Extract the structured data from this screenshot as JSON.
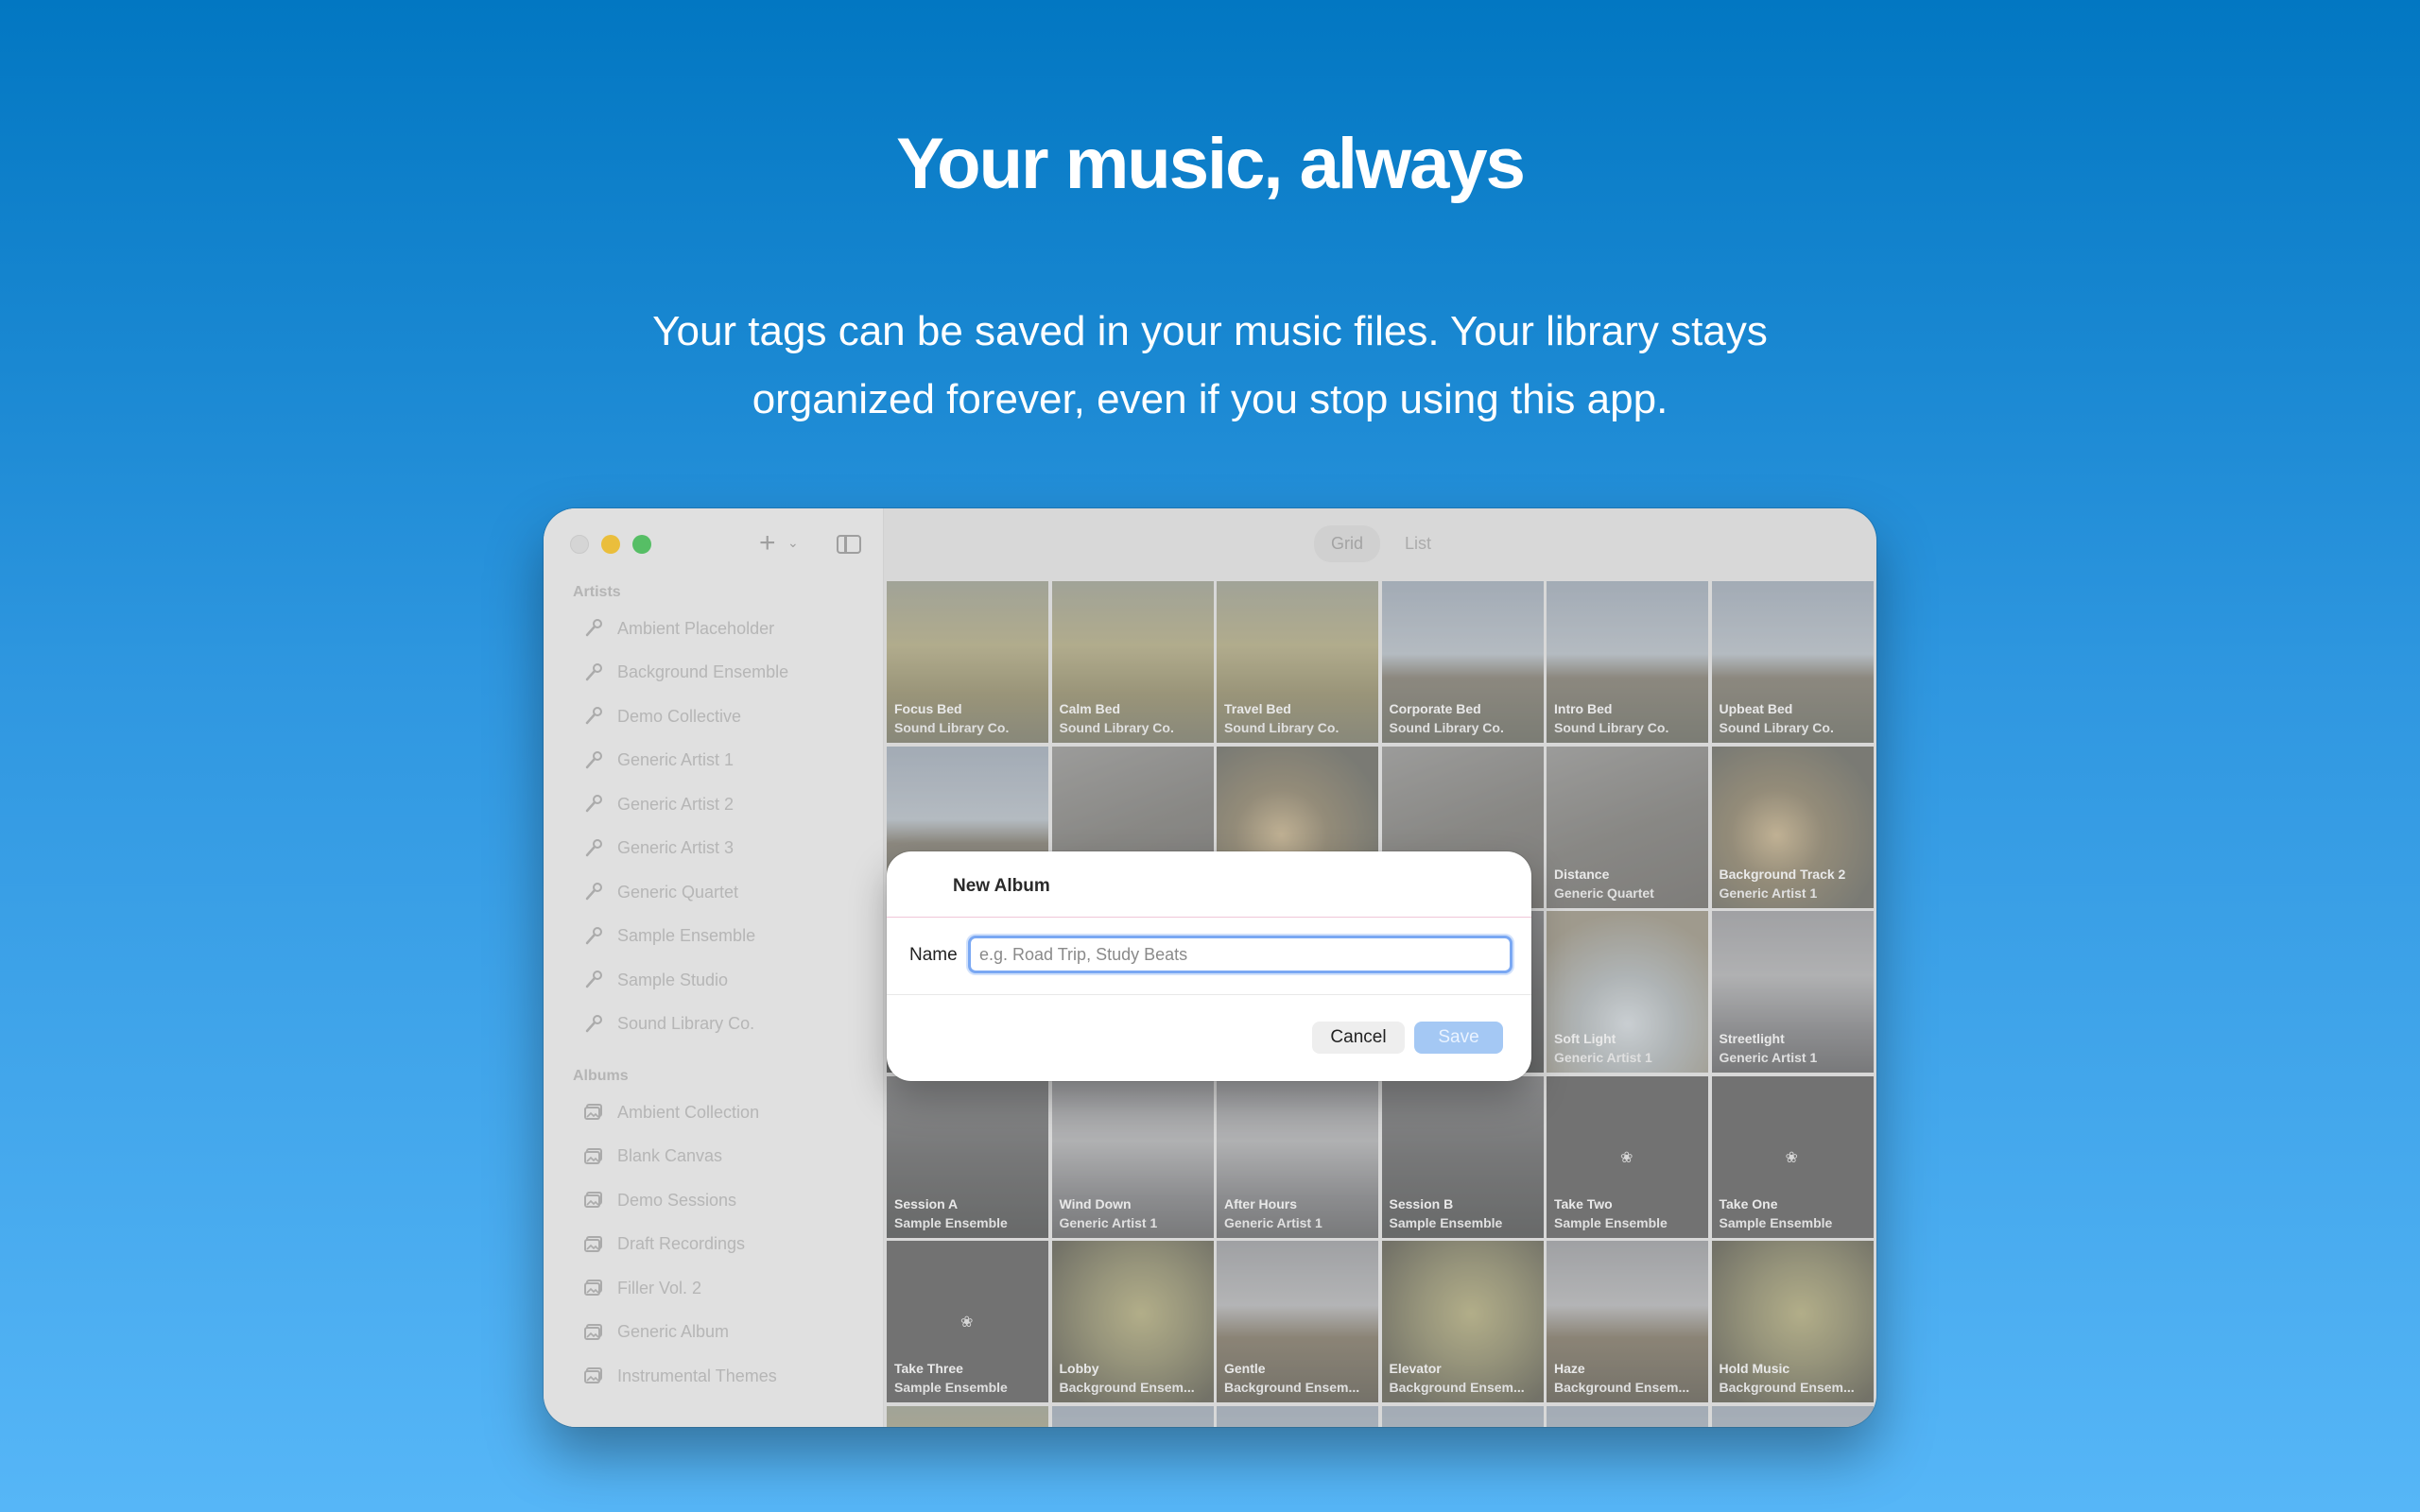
{
  "hero": {
    "title": "Your music, always",
    "subtitle_line1": "Your tags can be saved in your music files. Your library stays",
    "subtitle_line2": "organized forever, even if you stop using this app."
  },
  "sidebar": {
    "artists_label": "Artists",
    "artists": [
      "Ambient Placeholder",
      "Background Ensemble",
      "Demo Collective",
      "Generic Artist 1",
      "Generic Artist 2",
      "Generic Artist 3",
      "Generic Quartet",
      "Sample Ensemble",
      "Sample Studio",
      "Sound Library Co."
    ],
    "albums_label": "Albums",
    "albums": [
      "Ambient Collection",
      "Blank Canvas",
      "Demo Sessions",
      "Draft Recordings",
      "Filler Vol. 2",
      "Generic Album",
      "Instrumental Themes"
    ]
  },
  "toolbar": {
    "add_icon": "plus-icon",
    "sidebar_toggle_icon": "sidebar-icon",
    "grid_label": "Grid",
    "list_label": "List"
  },
  "grid": {
    "tiles": [
      {
        "title": "Focus Bed",
        "artist": "Sound Library Co.",
        "art": "field"
      },
      {
        "title": "Calm Bed",
        "artist": "Sound Library Co.",
        "art": "field"
      },
      {
        "title": "Travel Bed",
        "artist": "Sound Library Co.",
        "art": "field"
      },
      {
        "title": "Corporate Bed",
        "artist": "Sound Library Co.",
        "art": "coast"
      },
      {
        "title": "Intro Bed",
        "artist": "Sound Library Co.",
        "art": "coast"
      },
      {
        "title": "Upbeat Bed",
        "artist": "Sound Library Co.",
        "art": "coast"
      },
      {
        "title": "",
        "artist": "",
        "art": "coast"
      },
      {
        "title": "",
        "artist": "",
        "art": "grass"
      },
      {
        "title": "",
        "artist": "",
        "art": "seed"
      },
      {
        "title": "",
        "artist": "",
        "art": "grass"
      },
      {
        "title": "Distance",
        "artist": "Generic Quartet",
        "art": "grass"
      },
      {
        "title": "Background Track 2",
        "artist": "Generic Artist 1",
        "art": "seed"
      },
      {
        "title": "",
        "artist": "",
        "art": "tree"
      },
      {
        "title": "",
        "artist": "",
        "art": "dusk"
      },
      {
        "title": "",
        "artist": "",
        "art": "dusk"
      },
      {
        "title": "",
        "artist": "",
        "art": "tree"
      },
      {
        "title": "Soft Light",
        "artist": "Generic Artist 1",
        "art": "frost"
      },
      {
        "title": "Streetlight",
        "artist": "Generic Artist 1",
        "art": "dusk"
      },
      {
        "title": "Session A",
        "artist": "Sample Ensemble",
        "art": "tree"
      },
      {
        "title": "Wind Down",
        "artist": "Generic Artist 1",
        "art": "dusk"
      },
      {
        "title": "After Hours",
        "artist": "Generic Artist 1",
        "art": "dusk"
      },
      {
        "title": "Session B",
        "artist": "Sample Ensemble",
        "art": "tree"
      },
      {
        "title": "Take Two",
        "artist": "Sample Ensemble",
        "art": "dark"
      },
      {
        "title": "Take One",
        "artist": "Sample Ensemble",
        "art": "dark"
      },
      {
        "title": "Take Three",
        "artist": "Sample Ensemble",
        "art": "dark"
      },
      {
        "title": "Lobby",
        "artist": "Background Ensem...",
        "art": "pumpkin"
      },
      {
        "title": "Gentle",
        "artist": "Background Ensem...",
        "art": "lake"
      },
      {
        "title": "Elevator",
        "artist": "Background Ensem...",
        "art": "pumpkin"
      },
      {
        "title": "Haze",
        "artist": "Background Ensem...",
        "art": "lake"
      },
      {
        "title": "Hold Music",
        "artist": "Background Ensem...",
        "art": "pumpkin"
      },
      {
        "title": "",
        "artist": "",
        "art": "field"
      },
      {
        "title": "",
        "artist": "",
        "art": "coast"
      },
      {
        "title": "",
        "artist": "",
        "art": "coast"
      },
      {
        "title": "",
        "artist": "",
        "art": "coast"
      },
      {
        "title": "",
        "artist": "",
        "art": "coast"
      },
      {
        "title": "",
        "artist": "",
        "art": "coast"
      }
    ]
  },
  "dialog": {
    "title": "New Album",
    "name_label": "Name",
    "name_placeholder": "e.g. Road Trip, Study Beats",
    "name_value": "",
    "cancel_label": "Cancel",
    "save_label": "Save"
  },
  "colors": {
    "accent": "#7aa8f3",
    "save_disabled": "#a4c8f4",
    "background_top": "#0277c2",
    "background_bottom": "#56b6f7"
  }
}
